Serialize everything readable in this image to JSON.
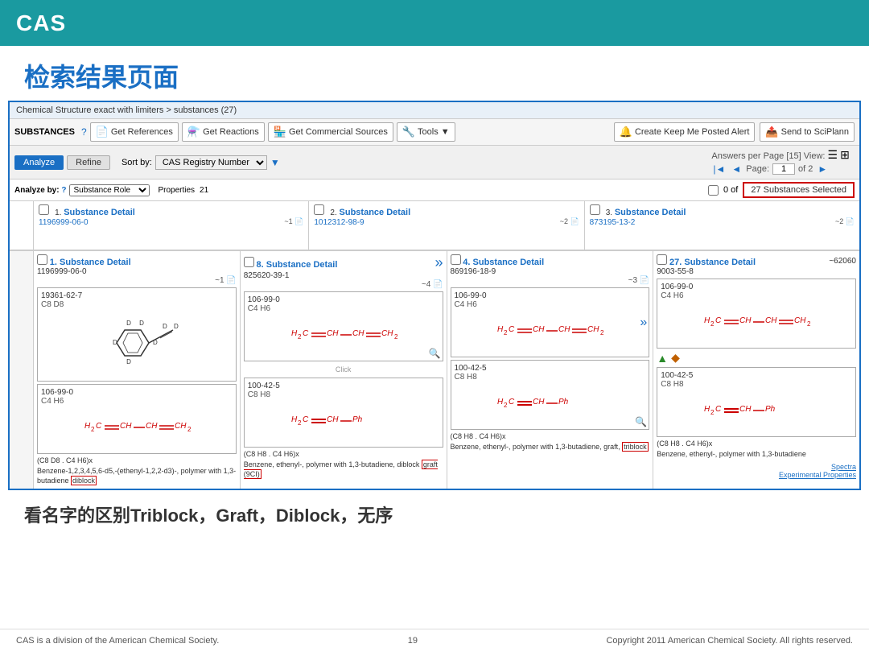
{
  "header": {
    "logo": "CAS",
    "bg_color": "#1a9aa0"
  },
  "page_title": "检索结果页面",
  "breadcrumb": "Chemical Structure exact with limiters > substances (27)",
  "toolbar": {
    "substances_label": "SUBSTANCES",
    "btn_get_references": "Get References",
    "btn_get_reactions": "Get Reactions",
    "btn_get_commercial": "Get Commercial Sources",
    "btn_tools": "Tools ▼",
    "btn_create_keep_me": "Create Keep Me Posted Alert",
    "btn_send_to_scifinder": "Send to SciPlann",
    "answers_per_page": "Answers per Page [15]",
    "view_label": "View:"
  },
  "tabs": {
    "analyze": "Analyze",
    "refine": "Refine",
    "sort_label": "Sort by:",
    "sort_value": "CAS Registry Number",
    "answers_info": "Answers per Page [15] View:"
  },
  "selection": {
    "checkbox": "",
    "count_text": "0 of 27 Substances Selected"
  },
  "pagination": {
    "prev": "◄",
    "page_label": "Page:",
    "page_current": "1",
    "page_of": "of 2",
    "next": "►"
  },
  "top_previews": [
    {
      "num": "1.",
      "title": "Substance Detail",
      "cas_number": "1196999-06-0",
      "ref": "~1"
    },
    {
      "num": "2.",
      "title": "Substance Detail",
      "cas_number": "1012312-98-9",
      "ref": "~2"
    },
    {
      "num": "3.",
      "title": "Substance Detail",
      "cas_number": "873195-13-2",
      "ref": "~2"
    }
  ],
  "cards": [
    {
      "num": "1.",
      "title": "Substance Detail",
      "cas_number": "1196999-06-0",
      "ref": "~1",
      "compounds": [
        {
          "cas": "19361-62-7",
          "formula": "C8 D8"
        },
        {
          "cas": "106-99-0",
          "formula": "C4 H6"
        },
        {
          "cas": "",
          "formula": ""
        }
      ],
      "formula_label": "(C8 D8 . C4 H6)x",
      "description": "Benzene-1,2,3,4,5,6-d5,-(ethenyl-1,2,2-d3)-, polymer with 1,3-butadiene",
      "highlight": "diblock"
    },
    {
      "num": "8.",
      "title": "Substance Detail",
      "cas_number": "825620-39-1",
      "ref": "~4",
      "compounds": [
        {
          "cas": "106-99-0",
          "formula": "C4 H6"
        },
        {
          "cas": "100-42-5",
          "formula": "C8 H8"
        }
      ],
      "formula_label": "(C8 H8 . C4 H6)x",
      "description": "Benzene, ethenyl-, polymer with 1,3-butadiene, diblock",
      "highlight": "graft (9CI)"
    },
    {
      "num": "4.",
      "title": "Substance Detail",
      "cas_number": "869196-18-9",
      "ref": "~3",
      "compounds": [
        {
          "cas": "106-99-0",
          "formula": "C4 H6"
        },
        {
          "cas": "100-42-5",
          "formula": "C8 H8"
        }
      ],
      "formula_label": "(C8 H8 . C4 H6)x",
      "description": "Benzene, ethenyl-, polymer with 1,3-butadiene, graft,",
      "highlight": "triblock"
    },
    {
      "num": "27.",
      "title": "Substance Detail",
      "cas_number": "9003-55-8",
      "ref": "~62060",
      "compounds": [
        {
          "cas": "106-99-0",
          "formula": "C4 H6"
        },
        {
          "cas": "100-42-5",
          "formula": "C8 H8"
        }
      ],
      "formula_label": "(C8 H8 . C4 H6)x",
      "description": "Benzene, ethenyl-, polymer with 1,3-butadiene",
      "highlight": "",
      "extra_links": [
        "Spectra",
        "Experimental Properties"
      ]
    }
  ],
  "bottom_note": "看名字的区别Triblock，Graft，Diblock，无序",
  "footer": {
    "left": "CAS is a division of the American Chemical Society.",
    "center": "19",
    "right": "Copyright 2011 American Chemical Society. All rights reserved."
  }
}
